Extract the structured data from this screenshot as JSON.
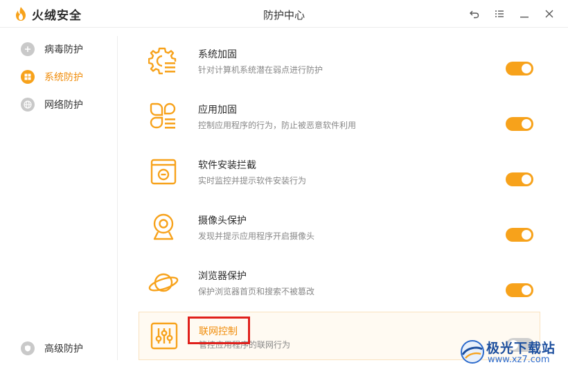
{
  "app": {
    "brand_name": "火绒安全",
    "window_title": "防护中心"
  },
  "window_controls": [
    "back-icon",
    "menu-icon",
    "minimize-icon",
    "close-icon"
  ],
  "sidebar": {
    "items": [
      {
        "label": "病毒防护",
        "icon": "virus-shield-icon",
        "active": false
      },
      {
        "label": "系统防护",
        "icon": "windows-icon",
        "active": true
      },
      {
        "label": "网络防护",
        "icon": "globe-icon",
        "active": false
      }
    ],
    "bottom_item": {
      "label": "高级防护",
      "icon": "advanced-shield-icon"
    }
  },
  "features": [
    {
      "title": "系统加固",
      "desc": "针对计算机系统潜在弱点进行防护",
      "icon": "gear-list-icon",
      "enabled": true
    },
    {
      "title": "应用加固",
      "desc": "控制应用程序的行为，防止被恶意软件利用",
      "icon": "apps-icon",
      "enabled": true
    },
    {
      "title": "软件安装拦截",
      "desc": "实时监控并提示软件安装行为",
      "icon": "install-block-icon",
      "enabled": true
    },
    {
      "title": "摄像头保护",
      "desc": "发现并提示应用程序开启摄像头",
      "icon": "webcam-icon",
      "enabled": true
    },
    {
      "title": "浏览器保护",
      "desc": "保护浏览器首页和搜索不被篡改",
      "icon": "planet-icon",
      "enabled": true
    },
    {
      "title": "联网控制",
      "desc": "管控应用程序的联网行为",
      "icon": "sliders-icon",
      "enabled": false
    }
  ],
  "watermark": {
    "line1": "极光下载站",
    "line2": "www.xz7.com"
  },
  "colors": {
    "accent": "#f7a21b",
    "accent_text": "#f08c0a",
    "highlight_border": "#e0201b",
    "watermark_blue": "#1d4f9e"
  }
}
